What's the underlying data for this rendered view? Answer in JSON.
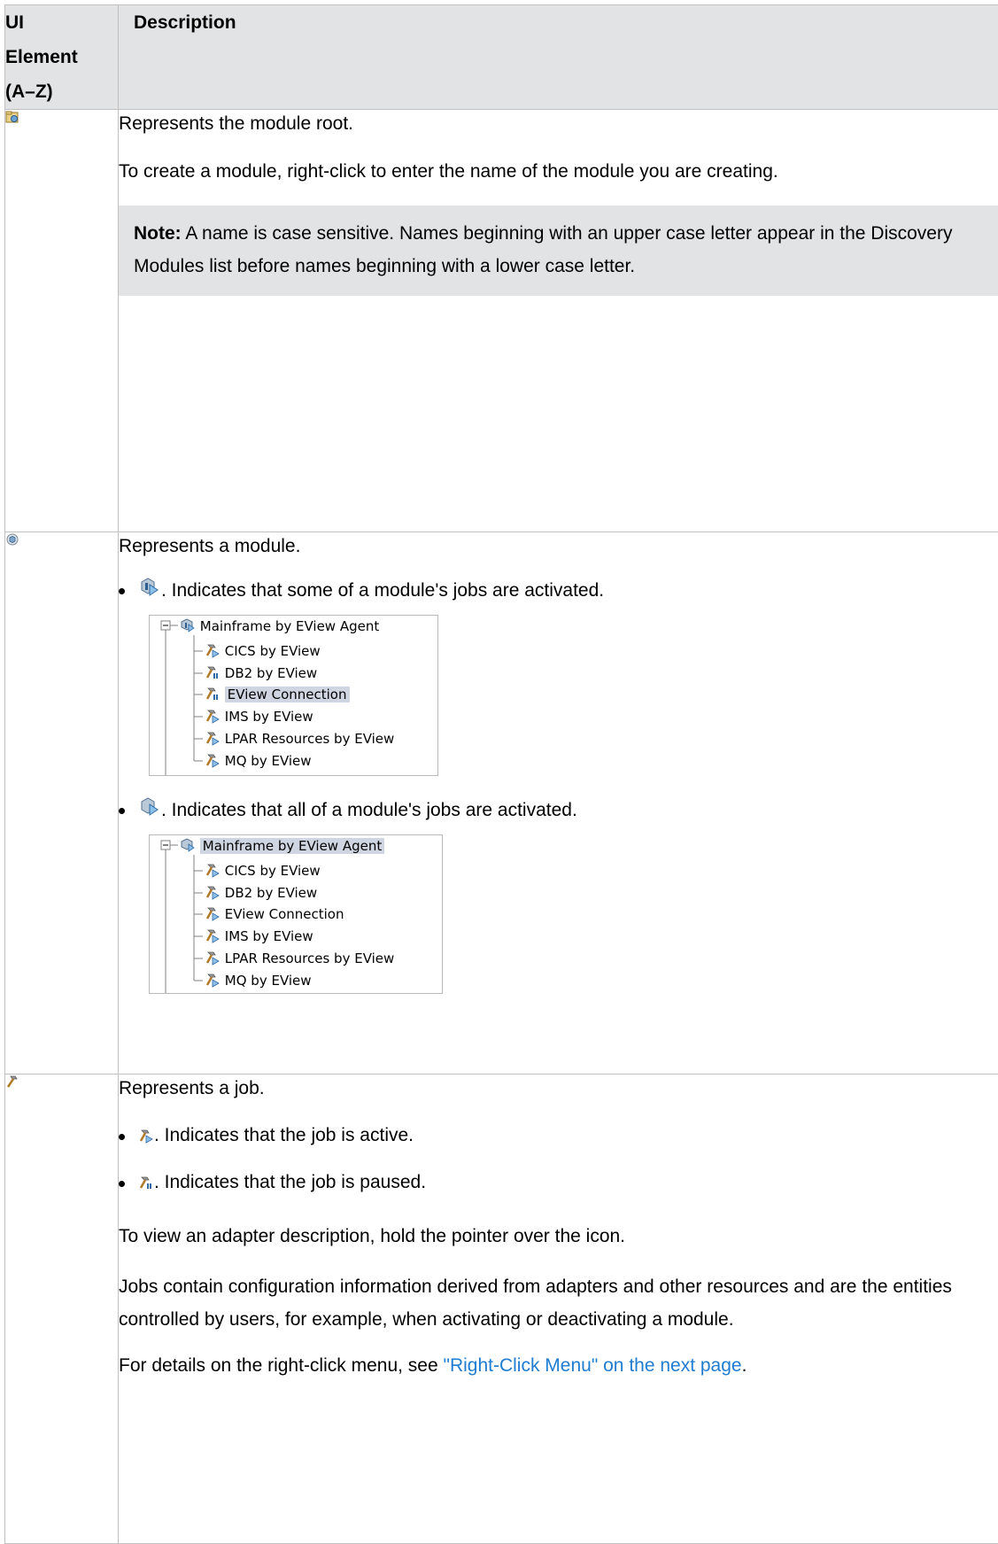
{
  "header": {
    "col1": [
      "UI",
      "Element",
      "(A–Z)"
    ],
    "col2": "Description"
  },
  "rows": {
    "module_root": {
      "icon": "module-root-icon",
      "text1": "Represents the module root.",
      "text2": "To create a module, right-click to enter the name of the module you are creating.",
      "note_label": "Note:",
      "note_text": " A name is case sensitive. Names beginning with an upper case letter appear in the Discovery Modules list before names beginning with a lower case letter."
    },
    "module": {
      "icon": "module-icon",
      "text1": "Represents a module.",
      "bullet1": ". Indicates that some of a module's jobs are activated.",
      "bullet2": ". Indicates that all of a module's jobs are activated.",
      "tree1": {
        "root": "Mainframe by EView Agent",
        "items": [
          "CICS by EView",
          "DB2 by EView",
          "EView Connection",
          "IMS by EView",
          "LPAR Resources by EView",
          "MQ by EView"
        ]
      },
      "tree2": {
        "root": "Mainframe by EView Agent",
        "items": [
          "CICS by EView",
          "DB2 by EView",
          "EView Connection",
          "IMS by EView",
          "LPAR Resources by EView",
          "MQ by EView"
        ]
      }
    },
    "job": {
      "icon": "job-icon",
      "text1": "Represents a job.",
      "bullet1": ". Indicates that the job is active.",
      "bullet2": ". Indicates that the job is paused.",
      "text2": "To view an adapter description, hold the pointer over the icon.",
      "text3": "Jobs contain configuration information derived from adapters and other resources and are the entities controlled by users, for example, when activating or deactivating a module.",
      "text4_prefix": "For details on the right-click menu, see ",
      "text4_link": "\"Right-Click Menu\" on the next page",
      "text4_suffix": "."
    }
  },
  "colors": {
    "header_bg": "#e2e3e4",
    "note_bg": "#e2e3e4",
    "border": "#c0c0c0",
    "link": "#1f7cd0",
    "tree_selection": "#cfd6e2"
  }
}
